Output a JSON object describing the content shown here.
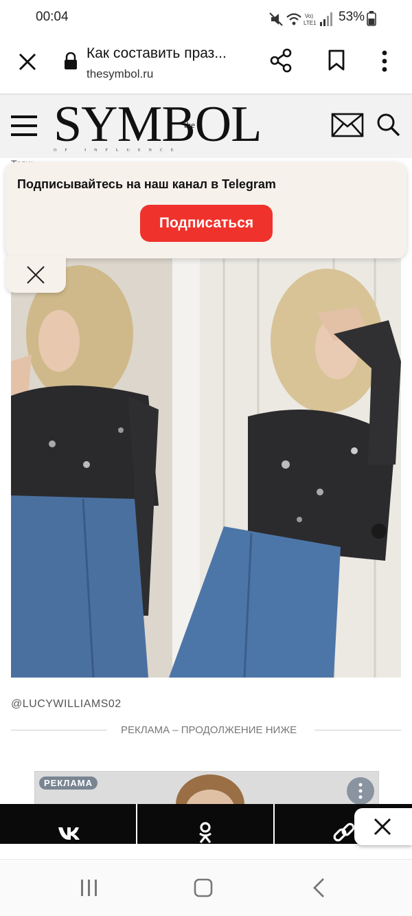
{
  "status_bar": {
    "time": "00:04",
    "battery": "53%",
    "network_label": "Vo) LTE1"
  },
  "browser": {
    "page_title": "Как составить праз...",
    "domain": "thesymbol.ru"
  },
  "site": {
    "logo": "SYMBOL",
    "logo_the": "the",
    "logo_tagline": "OF INFLUENCE"
  },
  "tags_line": "Теги: ...",
  "telegram_popup": {
    "title": "Подписывайтесь на наш канал в Telegram",
    "button_label": "Подписаться"
  },
  "photo": {
    "credit": "@LUCYWILLIAMS02"
  },
  "ad_divider": "РЕКЛАМА – ПРОДОЛЖЕНИЕ НИЖЕ",
  "ad": {
    "badge": "РЕКЛАМА"
  },
  "colors": {
    "subscribe": "#f0322c",
    "share_bar": "#0a0a0a",
    "popup_bg": "#f7f1ec"
  }
}
